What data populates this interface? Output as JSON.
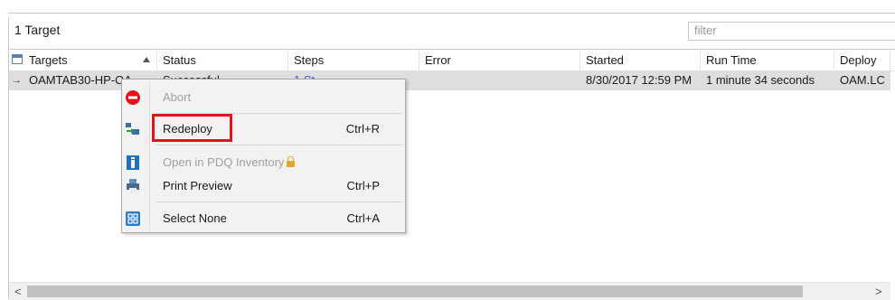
{
  "panel": {
    "title": "1 Target",
    "filter_placeholder": "filter"
  },
  "columns": [
    "Targets",
    "Status",
    "Steps",
    "Error",
    "Started",
    "Run Time",
    "Deploy"
  ],
  "row": {
    "target": "OAMTAB30-HP-OA",
    "status": "Successful",
    "steps": "1 St",
    "error": "",
    "started": "8/30/2017 12:59 PM",
    "run_time": "1 minute 34 seconds",
    "deploy": "OAM.LC"
  },
  "context_menu": {
    "items": [
      {
        "label": "Abort",
        "shortcut": "",
        "icon": "abort-icon",
        "enabled": false
      },
      {
        "label": "Redeploy",
        "shortcut": "Ctrl+R",
        "icon": "redeploy-icon",
        "enabled": true
      },
      {
        "label": "Open in PDQ Inventory",
        "shortcut": "",
        "icon": "pdq-inventory-icon",
        "enabled": false
      },
      {
        "label": "Print Preview",
        "shortcut": "Ctrl+P",
        "icon": "printer-icon",
        "enabled": true
      },
      {
        "label": "Select None",
        "shortcut": "Ctrl+A",
        "icon": "select-none-icon",
        "enabled": true
      }
    ],
    "highlighted_item": "Redeploy",
    "highlight_color": "#e0141b"
  },
  "scroll": {
    "left_arrow": "<",
    "right_arrow": ">",
    "up_arrow": "^",
    "down_arrow": "v"
  }
}
